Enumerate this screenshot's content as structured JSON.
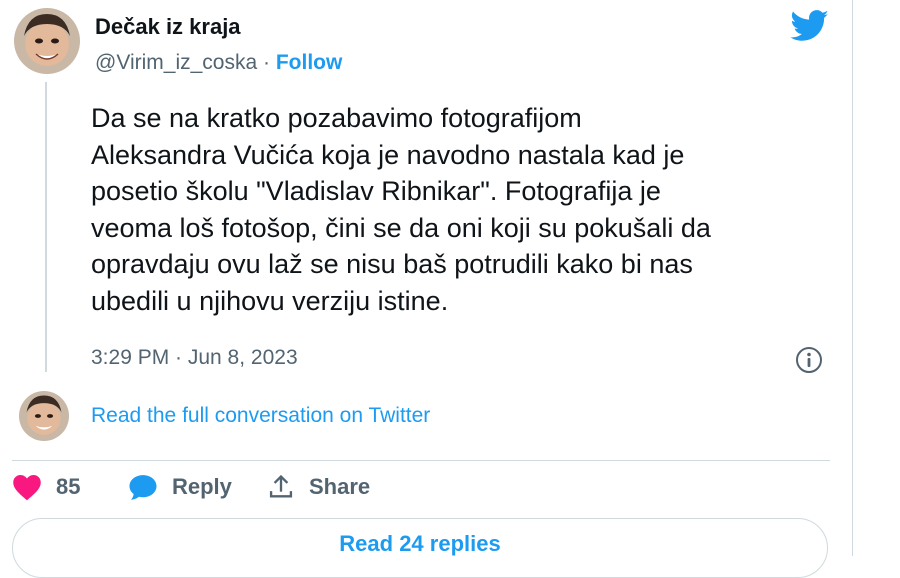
{
  "author": {
    "display_name": "Dečak iz kraja",
    "handle": "@Virim_iz_coska",
    "separator": " · ",
    "follow_label": "Follow"
  },
  "tweet": {
    "text": "Da se na kratko pozabavimo fotografijom\nAleksandra Vučića koja je navodno nastala kad je\nposetio školu \"Vladislav Ribnikar\". Fotografija je\nveoma loš fotošop, čini se da oni koji su pokušali da\nopravdaju ovu laž se nisu baš potrudili kako bi nas\nubedili u njihovu verziju istine.",
    "timestamp": "3:29 PM · Jun 8, 2023"
  },
  "conversation_link": "Read the full conversation on Twitter",
  "actions": {
    "like_count": "85",
    "reply_label": "Reply",
    "share_label": "Share"
  },
  "read_replies_label": "Read 24 replies",
  "colors": {
    "accent": "#1d9bf0",
    "like": "#f91880",
    "text": "#0f1419",
    "muted": "#536471",
    "border": "#cfd9de"
  },
  "icons": [
    "twitter-bird-icon",
    "info-icon",
    "heart-icon",
    "reply-bubble-icon",
    "share-icon"
  ]
}
